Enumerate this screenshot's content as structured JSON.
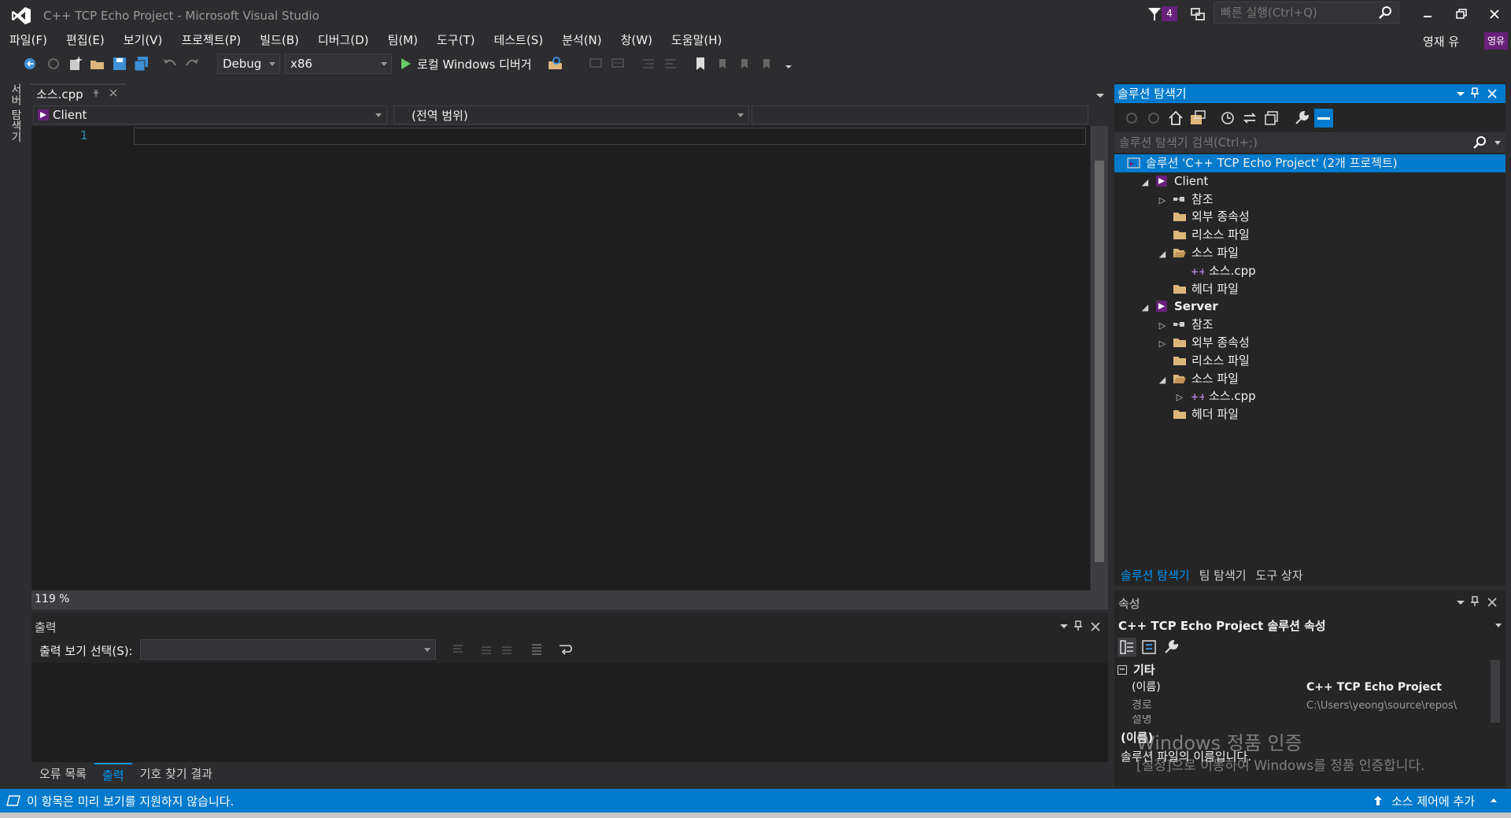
{
  "window": {
    "title": "C++ TCP Echo Project - Microsoft Visual Studio",
    "notification_count": "4",
    "quick_launch_placeholder": "빠른 실행(Ctrl+Q)",
    "user_name": "영재 유",
    "user_initials": "영유"
  },
  "menu": [
    "파일(F)",
    "편집(E)",
    "보기(V)",
    "프로젝트(P)",
    "빌드(B)",
    "디버그(D)",
    "팀(M)",
    "도구(T)",
    "테스트(S)",
    "분석(N)",
    "창(W)",
    "도움말(H)"
  ],
  "toolbar": {
    "config": "Debug",
    "platform": "x86",
    "run_label": "로컬 Windows 디버거"
  },
  "side_tab": "서버 탐색기",
  "editor": {
    "tab_label": "소스.cpp",
    "nav_project": "Client",
    "nav_scope": "(전역 범위)",
    "line_number": "1",
    "zoom": "119 %"
  },
  "output": {
    "title": "출력",
    "select_label": "출력 보기 선택(S):",
    "tabs": [
      "오류 목록",
      "출력",
      "기호 찾기 결과"
    ],
    "active_tab": "출력"
  },
  "solution_explorer": {
    "title": "솔루션 탐색기",
    "search_placeholder": "솔루션 탐색기 검색(Ctrl+;)",
    "tree": [
      {
        "label": "솔루션 'C++ TCP Echo Project' (2개 프로젝트)",
        "icon": "solution-icon",
        "level": 0,
        "expander": "",
        "selected": true
      },
      {
        "label": "Client",
        "icon": "project-icon",
        "level": 1,
        "expander": "open"
      },
      {
        "label": "참조",
        "icon": "references-icon",
        "level": 2,
        "expander": "closed"
      },
      {
        "label": "외부 종속성",
        "icon": "folder-icon",
        "level": 2,
        "expander": ""
      },
      {
        "label": "리소스 파일",
        "icon": "folder-icon",
        "level": 2,
        "expander": ""
      },
      {
        "label": "소스 파일",
        "icon": "folder-open-icon",
        "level": 2,
        "expander": "open"
      },
      {
        "label": "소스.cpp",
        "icon": "cpp-file-icon",
        "level": 3,
        "expander": ""
      },
      {
        "label": "헤더 파일",
        "icon": "folder-icon",
        "level": 2,
        "expander": ""
      },
      {
        "label": "Server",
        "icon": "project-icon",
        "level": 1,
        "expander": "open",
        "bold": true
      },
      {
        "label": "참조",
        "icon": "references-icon",
        "level": 2,
        "expander": "closed"
      },
      {
        "label": "외부 종속성",
        "icon": "folder-icon",
        "level": 2,
        "expander": "closed"
      },
      {
        "label": "리소스 파일",
        "icon": "folder-icon",
        "level": 2,
        "expander": ""
      },
      {
        "label": "소스 파일",
        "icon": "folder-open-icon",
        "level": 2,
        "expander": "open"
      },
      {
        "label": "소스.cpp",
        "icon": "cpp-file-icon",
        "level": 3,
        "expander": "closed"
      },
      {
        "label": "헤더 파일",
        "icon": "folder-icon",
        "level": 2,
        "expander": ""
      }
    ],
    "bottom_tabs": [
      "솔루션 탐색기",
      "팀 탐색기",
      "도구 상자"
    ],
    "active_tab": "솔루션 탐색기"
  },
  "properties": {
    "title": "속성",
    "object": "C++ TCP Echo Project 솔루션 속성",
    "category": "기타",
    "rows": [
      {
        "name": "(이름)",
        "value": "C++ TCP Echo Project"
      },
      {
        "name": "경로",
        "value": "C:\\Users\\yeong\\source\\repos\\"
      },
      {
        "name": "설명",
        "value": ""
      }
    ],
    "desc_title": "(이름)",
    "desc_text": "솔루션 파일의 이름입니다."
  },
  "watermark": {
    "title": "Windows 정품 인증",
    "subtitle": "[설정]으로 이동하여 Windows를 정품 인증합니다."
  },
  "status": {
    "left": "이 항목은 미리 보기를 지원하지 않습니다.",
    "right": "소스 제어에 추가"
  },
  "colors": {
    "accent": "#007acc",
    "badge": "#68217a",
    "background": "#2d2d30",
    "editor": "#1e1e1e"
  }
}
